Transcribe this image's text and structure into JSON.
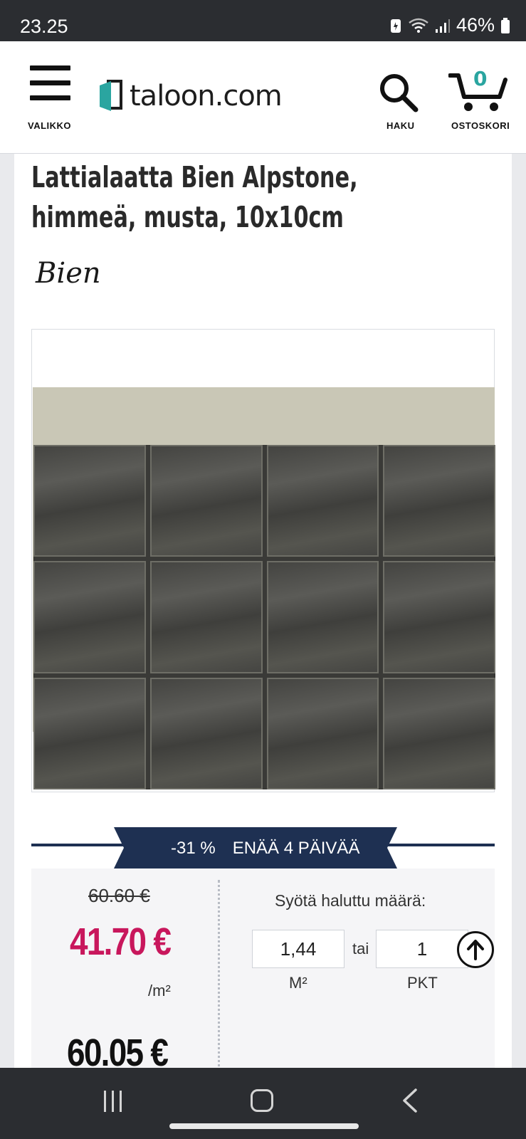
{
  "status_bar": {
    "time": "23.25",
    "battery": "46%",
    "icons": [
      "battery-saver-icon",
      "wifi-icon",
      "signal-icon",
      "battery-icon"
    ]
  },
  "header": {
    "menu_label": "VALIKKO",
    "logo_text": "taloon.com",
    "search_label": "HAKU",
    "cart_label": "OSTOSKORI",
    "cart_count": "0"
  },
  "product": {
    "title_line1": "Lattialaatta Bien Alpstone,",
    "title_line2": "himmeä, musta, 10x10cm",
    "brand": "Bien",
    "image_alt": "tile-grid-image"
  },
  "promo": {
    "discount": "-31 %",
    "days_left": "ENÄÄ 4 PÄIVÄÄ"
  },
  "pricing": {
    "old_price": "60.60 €",
    "new_price": "41.70 €",
    "unit": "/m²",
    "package_price": "60.05 €"
  },
  "quantity": {
    "label": "Syötä haluttu määrä:",
    "m2_value": "1,44",
    "pkt_value": "1",
    "or_text": "tai",
    "m2_unit": "M²",
    "pkt_unit": "PKT"
  },
  "colors": {
    "accent_price": "#c8175c",
    "banner": "#1e3052",
    "logo_teal": "#2aa5a0"
  }
}
